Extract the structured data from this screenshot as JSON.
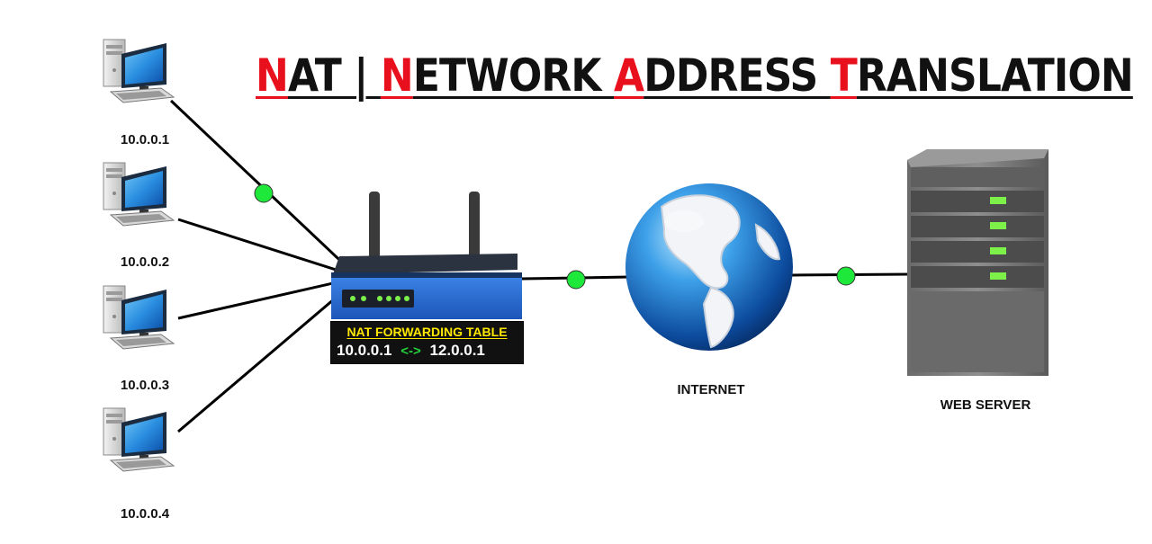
{
  "title": {
    "segments": [
      {
        "text": "N",
        "color": "#e8101c"
      },
      {
        "text": "AT | ",
        "color": "#111111"
      },
      {
        "text": "N",
        "color": "#e8101c"
      },
      {
        "text": "ETWORK ",
        "color": "#111111"
      },
      {
        "text": "A",
        "color": "#e8101c"
      },
      {
        "text": "DDRESS ",
        "color": "#111111"
      },
      {
        "text": "T",
        "color": "#e8101c"
      },
      {
        "text": "RANSLATION",
        "color": "#111111"
      }
    ]
  },
  "hosts": [
    {
      "ip": "10.0.0.1",
      "icon": "desktop-computer-icon"
    },
    {
      "ip": "10.0.0.2",
      "icon": "desktop-computer-icon"
    },
    {
      "ip": "10.0.0.3",
      "icon": "desktop-computer-icon"
    },
    {
      "ip": "10.0.0.4",
      "icon": "desktop-computer-icon"
    }
  ],
  "router": {
    "icon": "router-icon",
    "table_title": "NAT FORWARDING TABLE",
    "mapping": {
      "private": "10.0.0.1",
      "arrow": "<->",
      "public": "12.0.0.1"
    }
  },
  "internet": {
    "label": "INTERNET",
    "icon": "globe-icon"
  },
  "server": {
    "label": "WEB SERVER",
    "icon": "server-tower-icon"
  },
  "colors": {
    "accent_red": "#e8101c",
    "table_header_yellow": "#ffe800",
    "arrow_green": "#22d43a",
    "link_dot_green": "#1ee83a",
    "router_blue": "#2f6fd6",
    "server_led_green": "#7df04a"
  }
}
